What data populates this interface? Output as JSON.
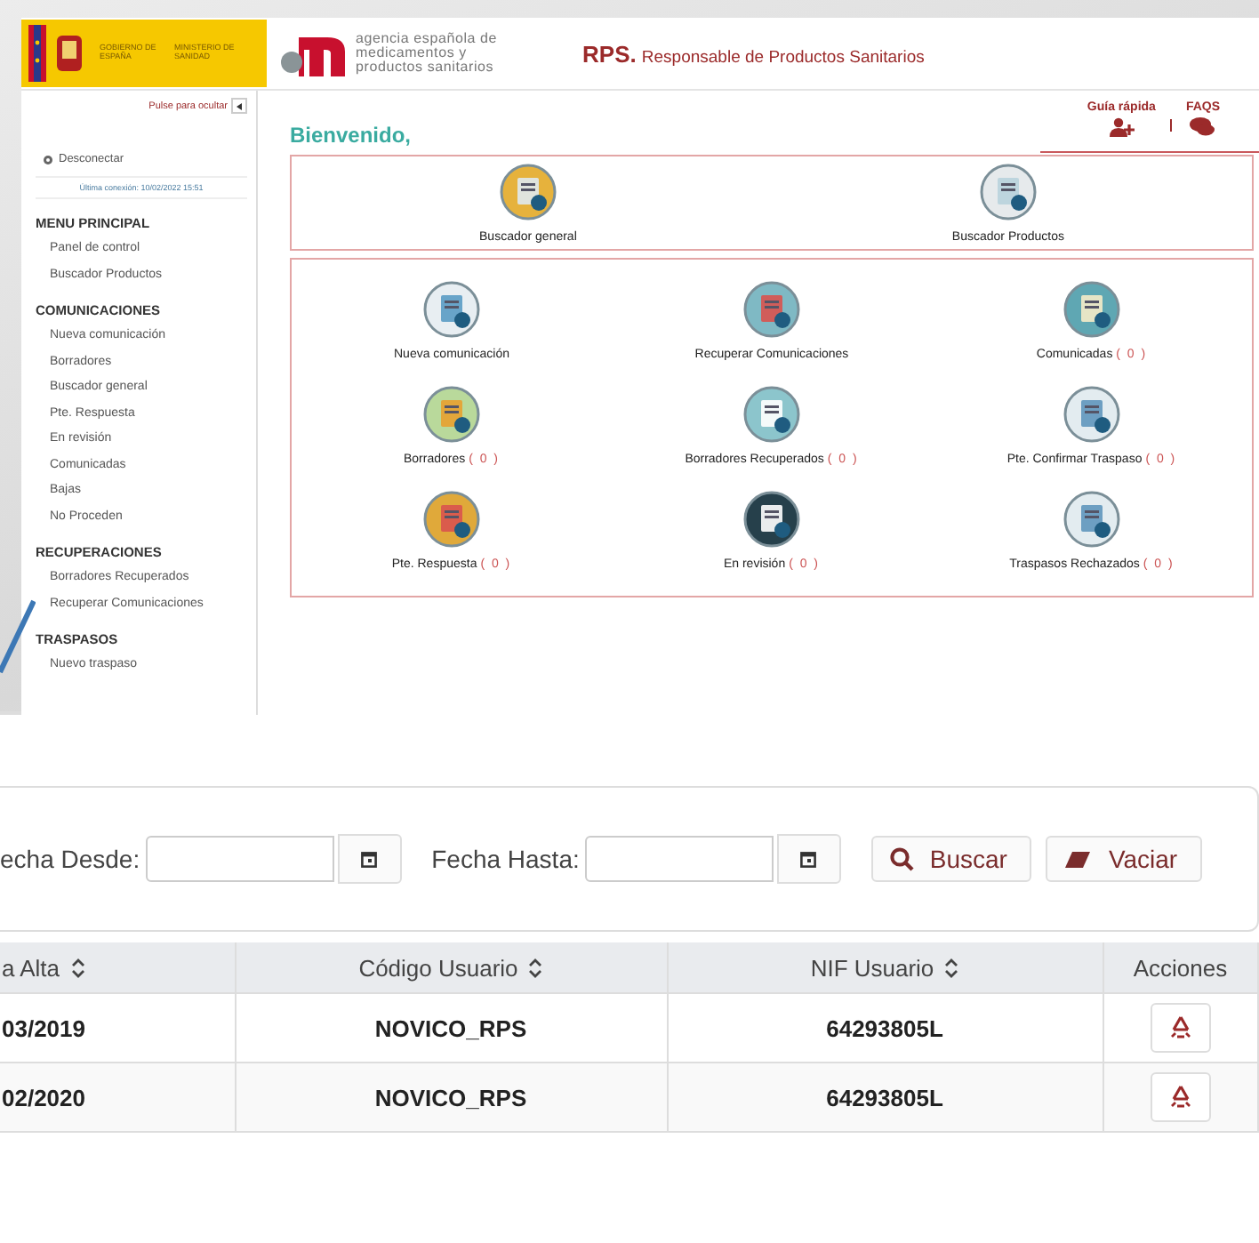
{
  "header": {
    "gov_logo": {
      "line1": "GOBIERNO DE ESPAÑA",
      "line2": "MINISTERIO DE SANIDAD"
    },
    "agency_logo": {
      "lines": [
        "agencia española de",
        "medicamentos y",
        "productos sanitarios"
      ]
    },
    "app_title": {
      "code": "RPS.",
      "name": "Responsable de Productos Sanitarios"
    }
  },
  "sidebar": {
    "hide_toggle": "Pulse para ocultar",
    "logout": "Desconectar",
    "last_login": "Última conexión: 10/02/2022 15:51",
    "sections": [
      {
        "title": "MENU PRINCIPAL",
        "items": [
          "Panel de control",
          "Buscador Productos"
        ]
      },
      {
        "title": "COMUNICACIONES",
        "items": [
          "Nueva comunicación",
          "Borradores",
          "Buscador general",
          "Pte. Respuesta",
          "En revisión",
          "Comunicadas",
          "Bajas",
          "No Proceden"
        ]
      },
      {
        "title": "RECUPERACIONES",
        "items": [
          "Borradores Recuperados",
          "Recuperar Comunicaciones"
        ]
      },
      {
        "title": "TRASPASOS",
        "items": [
          "Nuevo traspaso"
        ]
      }
    ]
  },
  "welcome": "Bienvenido,",
  "help_links": [
    {
      "label": "Guía rápida"
    },
    {
      "label": "FAQS"
    }
  ],
  "search_tiles": [
    {
      "label": "Buscador general"
    },
    {
      "label": "Buscador Productos"
    }
  ],
  "tiles": [
    {
      "label": "Nueva comunicación"
    },
    {
      "label": "Recuperar Comunicaciones"
    },
    {
      "label": "Comunicadas",
      "count": "( 0 )"
    },
    {
      "label": "Borradores",
      "count": "( 0 )"
    },
    {
      "label": "Borradores Recuperados",
      "count": "( 0 )"
    },
    {
      "label": "Pte. Confirmar Traspaso",
      "count": "( 0 )"
    },
    {
      "label": "Pte. Respuesta",
      "count": "( 0 )"
    },
    {
      "label": "En revisión",
      "count": "( 0 )"
    },
    {
      "label": "Traspasos Rechazados",
      "count": "( 0 )"
    }
  ],
  "filter": {
    "fields": [
      {
        "label": "echa Desde:"
      },
      {
        "label": "Fecha Hasta:"
      }
    ],
    "buttons": [
      {
        "label": "Buscar",
        "kind": "search"
      },
      {
        "label": "Vaciar",
        "kind": "clear"
      }
    ]
  },
  "table": {
    "columns": [
      {
        "label": "a Alta",
        "sortable": true
      },
      {
        "label": "Código Usuario",
        "sortable": true
      },
      {
        "label": "NIF Usuario",
        "sortable": true
      },
      {
        "label": "Acciones",
        "sortable": false
      }
    ],
    "rows": [
      {
        "cells": [
          "03/2019",
          "NOVICO_RPS",
          "64293805L"
        ]
      },
      {
        "cells": [
          "02/2020",
          "NOVICO_RPS",
          "64293805L"
        ]
      }
    ]
  }
}
